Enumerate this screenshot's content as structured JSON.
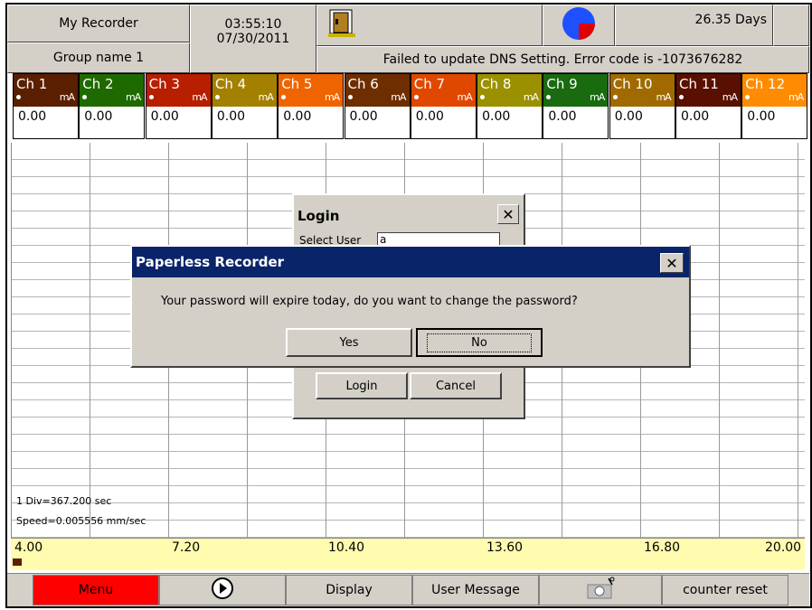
{
  "header": {
    "title": "My Recorder",
    "group": "Group name 1",
    "time": "03:55:10",
    "date": "07/30/2011",
    "days_left": "26.35 Days",
    "status_message": "Failed to update DNS Setting. Error code is -1073676282"
  },
  "channels": [
    {
      "name": "Ch 1",
      "unit": "mA",
      "value": "0.00",
      "color": "#5a1e00"
    },
    {
      "name": "Ch 2",
      "unit": "mA",
      "value": "0.00",
      "color": "#1f6a00"
    },
    {
      "name": "Ch 3",
      "unit": "mA",
      "value": "0.00",
      "color": "#b81e00"
    },
    {
      "name": "Ch 4",
      "unit": "mA",
      "value": "0.00",
      "color": "#a38000"
    },
    {
      "name": "Ch 5",
      "unit": "mA",
      "value": "0.00",
      "color": "#f06400"
    },
    {
      "name": "Ch 6",
      "unit": "mA",
      "value": "0.00",
      "color": "#6e2e00"
    },
    {
      "name": "Ch 7",
      "unit": "mA",
      "value": "0.00",
      "color": "#e04800"
    },
    {
      "name": "Ch 8",
      "unit": "mA",
      "value": "0.00",
      "color": "#9a9000"
    },
    {
      "name": "Ch 9",
      "unit": "mA",
      "value": "0.00",
      "color": "#1a6a10"
    },
    {
      "name": "Ch 10",
      "unit": "mA",
      "value": "0.00",
      "color": "#a06a00"
    },
    {
      "name": "Ch 11",
      "unit": "mA",
      "value": "0.00",
      "color": "#5a1000"
    },
    {
      "name": "Ch 12",
      "unit": "mA",
      "value": "0.00",
      "color": "#ff8c00"
    }
  ],
  "chart": {
    "div_label": "1 Div=367.200 sec",
    "speed_label": "Speed=0.005556 mm/sec",
    "scale": [
      "4.00",
      "7.20",
      "10.40",
      "13.60",
      "16.80",
      "20.00"
    ]
  },
  "toolbar": {
    "menu": "Menu",
    "display": "Display",
    "user_message": "User Message",
    "counter_reset": "counter reset",
    "menu_color": "#ff0000"
  },
  "login_dialog": {
    "title": "Login",
    "select_user_label": "Select User",
    "select_user_value": "a",
    "login_button": "Login",
    "cancel_button": "Cancel"
  },
  "alert_dialog": {
    "title": "Paperless Recorder",
    "message": "Your password will expire today, do you want to change the password?",
    "yes_button": "Yes",
    "no_button": "No",
    "title_bar_color": "#0a246a"
  }
}
